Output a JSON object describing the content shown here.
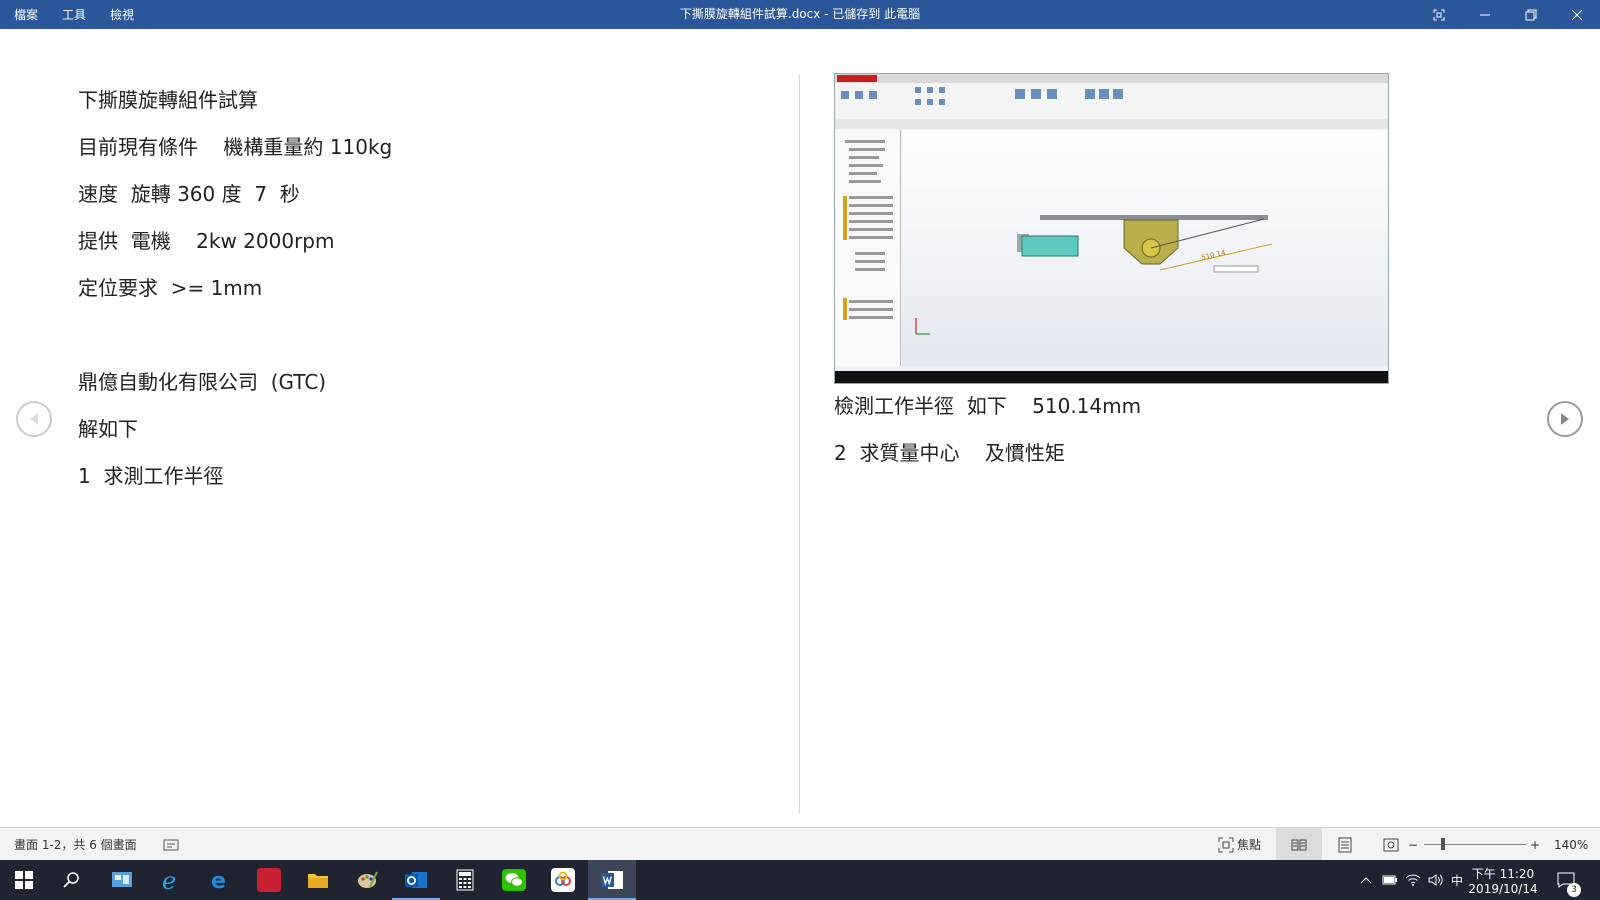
{
  "titlebar": {
    "menu": [
      "檔案",
      "工具",
      "檢視"
    ],
    "title": "下撕膜旋轉組件試算.docx - 已儲存到 此電腦"
  },
  "document": {
    "left_lines": [
      "下撕膜旋轉組件試算",
      "目前現有條件    機構重量約 110kg",
      "速度  旋轉 360 度  7  秒",
      "提供  電機    2kw 2000rpm",
      "定位要求  >= 1mm",
      "鼎億自動化有限公司  (GTC)",
      "解如下",
      "1  求測工作半徑"
    ],
    "right_lines": [
      "檢測工作半徑  如下    510.14mm",
      "2  求質量中心    及慣性矩"
    ],
    "embedded_image": {
      "dimension_label": "510.14"
    }
  },
  "statusbar": {
    "page_info": "畫面 1-2，共 6 個畫面",
    "focus": "焦點",
    "zoom": "140%"
  },
  "taskbar": {
    "clock_time": "下午 11:20",
    "clock_date": "2019/10/14",
    "ime": "中",
    "notification_count": "3"
  }
}
